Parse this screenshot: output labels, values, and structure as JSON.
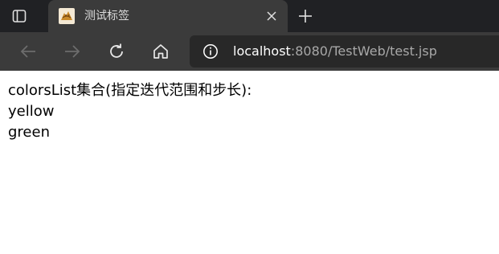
{
  "browser": {
    "tab": {
      "title": "测试标签",
      "favicon": "tomcat-icon"
    },
    "address": {
      "host": "localhost",
      "path": ":8080/TestWeb/test.jsp"
    },
    "icons": {
      "tab_actions": "tab-actions-icon",
      "close": "close-icon",
      "new_tab": "plus-icon",
      "back": "back-arrow-icon",
      "forward": "forward-arrow-icon",
      "refresh": "refresh-icon",
      "home": "home-icon",
      "site_info": "info-icon"
    },
    "colors": {
      "tabbar_bg": "#202124",
      "toolbar_bg": "#3b3b3b",
      "addressbar_bg": "#282828",
      "host_text": "#ffffff",
      "path_text": "#a8a8a8"
    }
  },
  "page": {
    "lines": [
      "colorsList集合(指定迭代范围和步长):",
      "yellow",
      "green"
    ]
  }
}
